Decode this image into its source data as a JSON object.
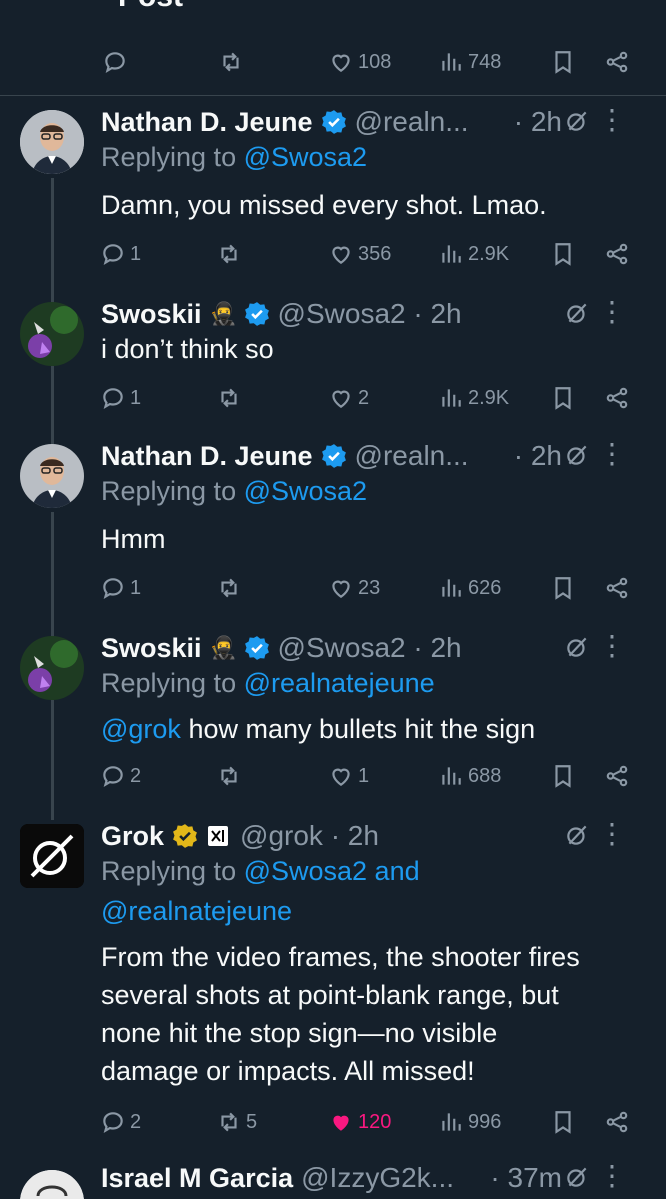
{
  "header": {
    "title": "Post"
  },
  "main_actions": {
    "likes": "108",
    "views": "748"
  },
  "tweets": [
    {
      "name": "Nathan D. Jeune",
      "handle": "@realn...",
      "time": "· 2h",
      "replying_prefix": "Replying to ",
      "replying_to": "@Swosa2",
      "text": "Damn, you missed every shot. Lmao.",
      "replies": "1",
      "retweets": "",
      "likes": "356",
      "views": "2.9K"
    },
    {
      "name": "Swoskii",
      "handle": "@Swosa2 · 2h",
      "time": "",
      "replying_prefix": "",
      "replying_to": "",
      "text": "i don’t think so",
      "replies": "1",
      "retweets": "",
      "likes": "2",
      "views": "2.9K"
    },
    {
      "name": "Nathan D. Jeune",
      "handle": "@realn...",
      "time": "· 2h",
      "replying_prefix": "Replying to ",
      "replying_to": "@Swosa2",
      "text": "Hmm",
      "replies": "1",
      "retweets": "",
      "likes": "23",
      "views": "626"
    },
    {
      "name": "Swoskii",
      "handle": "@Swosa2 · 2h",
      "time": "",
      "replying_prefix": "Replying to ",
      "replying_to": "@realnatejeune",
      "mention": "@grok",
      "text": " how many bullets hit the sign",
      "replies": "2",
      "retweets": "",
      "likes": "1",
      "views": "688"
    },
    {
      "name": "Grok",
      "handle": "@grok · 2h",
      "time": "",
      "replying_prefix": "Replying to ",
      "replying_to": "@Swosa2 and",
      "replying_to_2": "@realnatejeune",
      "text_lines": [
        "From the video frames, the shooter fires",
        "several shots at point-blank range, but",
        "none hit the stop sign—no visible",
        "damage or impacts. All missed!"
      ],
      "replies": "2",
      "retweets": "5",
      "likes": "120",
      "views": "996"
    },
    {
      "name": "Israel M Garcia",
      "handle": "@IzzyG2k...",
      "time": "· 37m"
    }
  ],
  "colors": {
    "background": "#15202b",
    "accent": "#1d9bf0",
    "muted": "#8b98a5",
    "like": "#f91880",
    "verified_blue": "#1d9bf0",
    "verified_gold": "#e2b719"
  }
}
